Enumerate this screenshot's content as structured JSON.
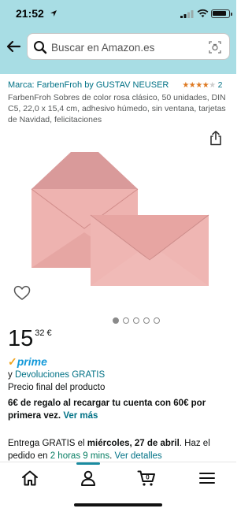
{
  "status_bar": {
    "time": "21:52"
  },
  "search": {
    "placeholder": "Buscar en Amazon.es"
  },
  "product": {
    "brand_link": "Marca: FarbenFroh by GUSTAV NEUSER",
    "rating_count": "2",
    "rating_stars": 4,
    "title": "FarbenFroh Sobres de color rosa clásico, 50 unidades, DIN C5, 22,0 x 15,4 cm, adhesivo húmedo, sin ventana, tarjetas de Navidad, felicitaciones",
    "image_count": 5,
    "active_image": 1
  },
  "price": {
    "whole": "15",
    "fraction": "32 €"
  },
  "prime": {
    "label": "prime"
  },
  "returns": {
    "prefix": "y ",
    "link": "Devoluciones GRATIS"
  },
  "final_price_note": "Precio final del producto",
  "promo": {
    "text": "6€ de regalo al recargar tu cuenta con 60€ por primera vez.",
    "link": "Ver más"
  },
  "delivery": {
    "part1": "Entrega GRATIS el ",
    "date": "miércoles, 27 de abril",
    "part2": ". Haz el pedido en ",
    "countdown": "2 horas 9 mins",
    "part3": ". ",
    "link": "Ver detalles"
  },
  "colors": {
    "header_bg": "#a8dde4",
    "link": "#007185",
    "star": "#de7921",
    "prime_blue": "#1399d9",
    "envelope_pink": "#e8a8a8"
  },
  "nav_icons": [
    "home-icon",
    "account-icon",
    "cart-icon",
    "menu-icon"
  ]
}
